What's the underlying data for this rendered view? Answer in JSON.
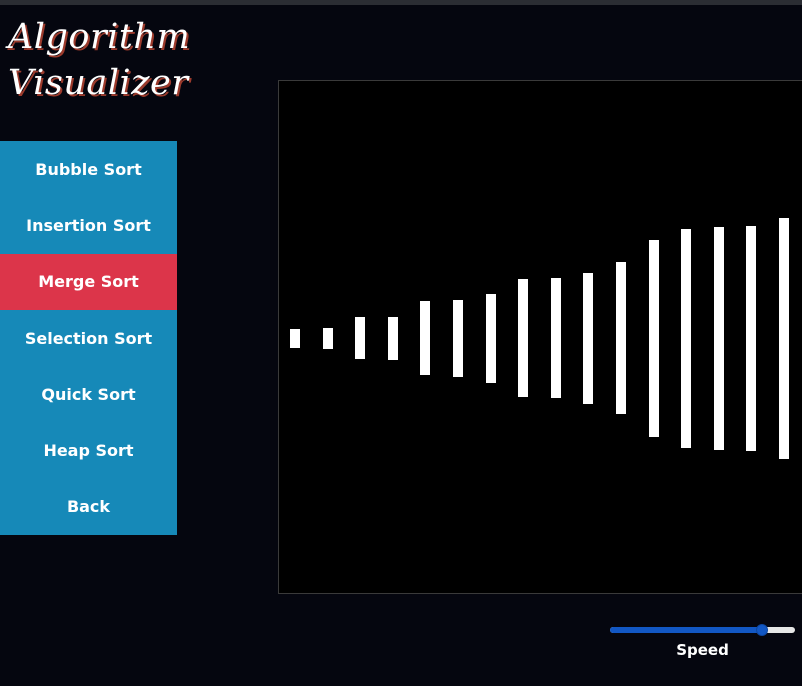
{
  "app": {
    "title_line1": "Algorithm",
    "title_line2": "Visualizer"
  },
  "menu": {
    "items": [
      {
        "label": "Bubble Sort"
      },
      {
        "label": "Insertion Sort"
      },
      {
        "label": "Merge Sort",
        "active": true
      },
      {
        "label": "Selection Sort"
      },
      {
        "label": "Quick Sort"
      },
      {
        "label": "Heap Sort"
      },
      {
        "label": "Back"
      }
    ]
  },
  "visualizer": {
    "bar_values": [
      19,
      21,
      42,
      43,
      74,
      77,
      89,
      118,
      120,
      131,
      152,
      197,
      219,
      223,
      225,
      241
    ]
  },
  "speed": {
    "label": "Speed",
    "value": 0.82
  },
  "colors": {
    "background": "#05060f",
    "menu": "#1689b8",
    "menu_active": "#dc354a",
    "bar": "#ffffff",
    "slider": "#1257c4"
  }
}
